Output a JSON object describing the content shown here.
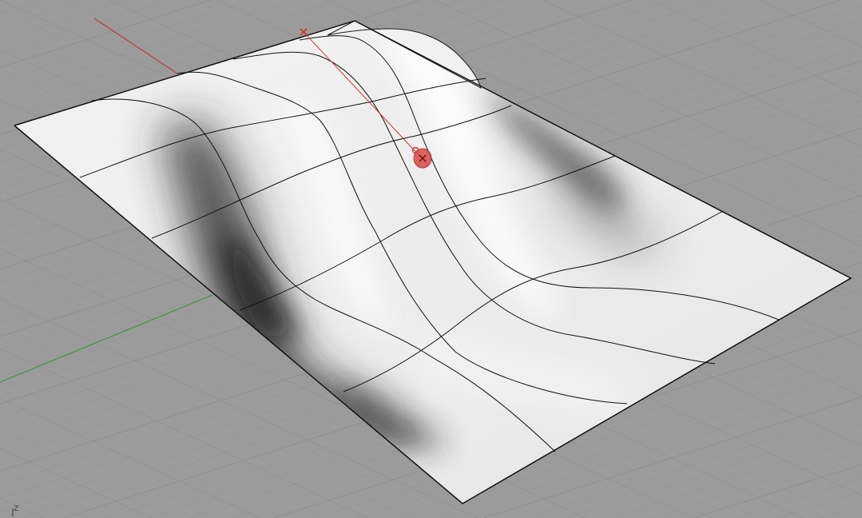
{
  "viewport": {
    "axis_indicator_label": "Z"
  },
  "colors": {
    "background": "#9b9b9b",
    "grid_minor": "#8f8f8f",
    "grid_major": "#858585",
    "x_axis": "#c62828",
    "y_axis": "#2e9a2e",
    "surface_edge": "#111111",
    "isocurve": "#111111",
    "gumball": "#d32f2f"
  }
}
